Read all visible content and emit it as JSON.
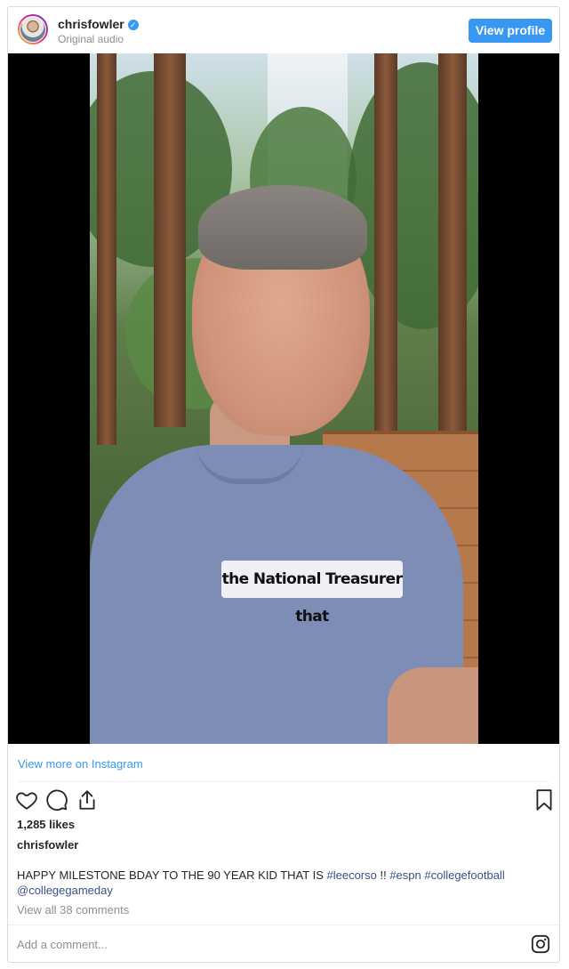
{
  "header": {
    "username": "chrisfowler",
    "verified_mark": "✓",
    "audio_label": "Original audio",
    "view_profile_label": "View profile"
  },
  "video": {
    "caption_overlay": "the National Treasurer that"
  },
  "links": {
    "view_more": "View more on Instagram",
    "view_comments": "View all 38 comments"
  },
  "post": {
    "likes": "1,285 likes",
    "author": "chrisfowler",
    "caption_text": "HAPPY MILESTONE BDAY TO THE 90 YEAR KID THAT IS ",
    "hashtags": [
      "#leecorso",
      " !! ",
      "#espn",
      " ",
      "#collegefootball"
    ],
    "mention": "@collegegameday"
  },
  "comment": {
    "placeholder": "Add a comment..."
  },
  "icons": {
    "like": "heart-icon",
    "comment": "comment-icon",
    "share": "share-icon",
    "save": "bookmark-icon",
    "instagram": "instagram-icon"
  },
  "colors": {
    "accent": "#3897f0",
    "hashtag": "#385185",
    "muted": "#8e8e8e"
  }
}
